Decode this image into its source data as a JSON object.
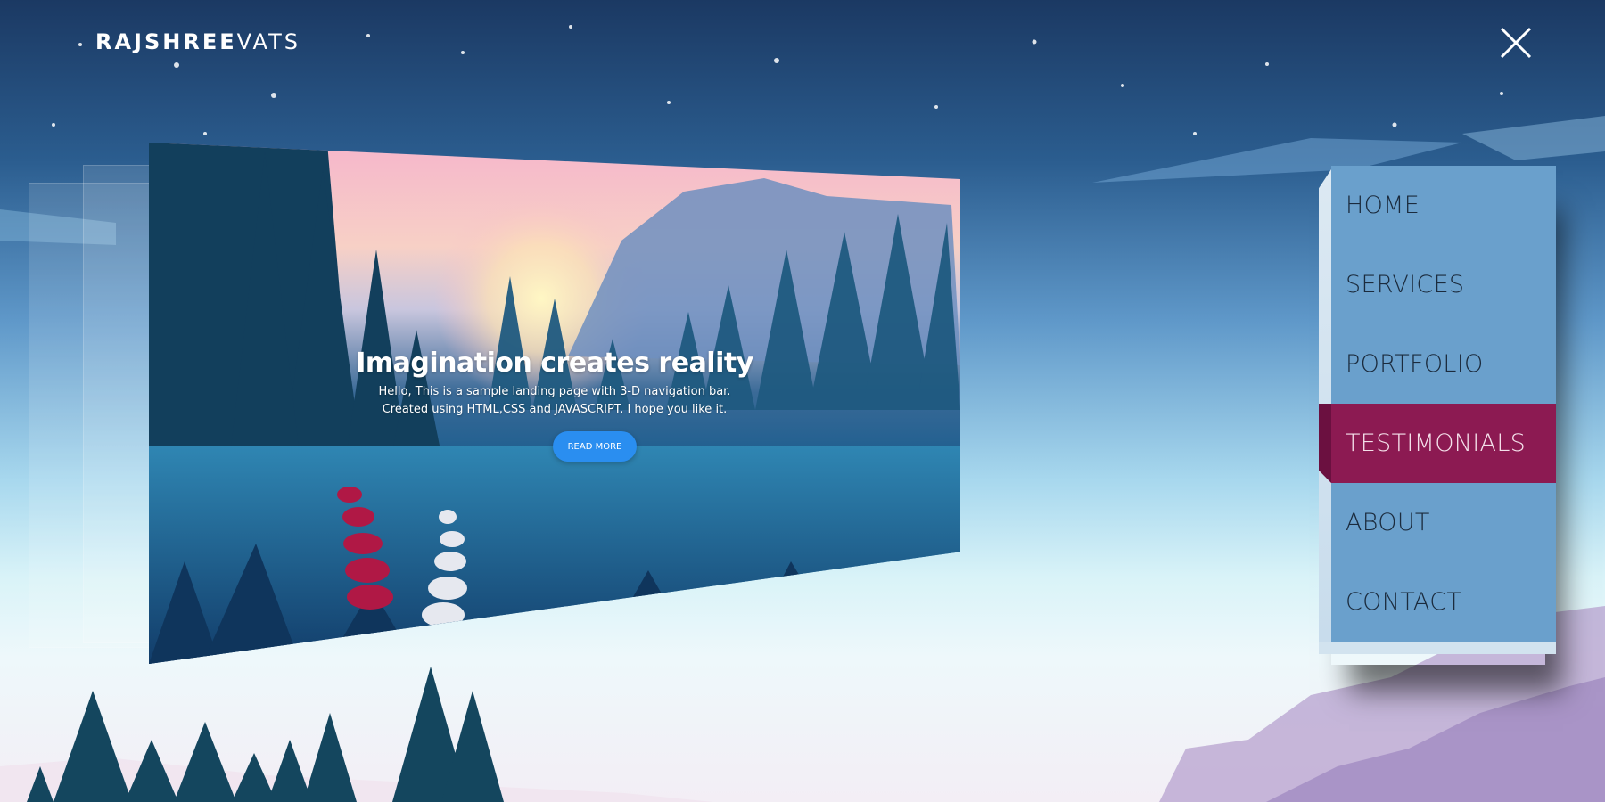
{
  "brand": {
    "bold": "RAJSHREE",
    "thin": "VATS"
  },
  "hero": {
    "title": "Imagination creates reality",
    "line1": "Hello, This is a sample landing page with 3-D navigation bar.",
    "line2": "Created using HTML,CSS and JAVASCRIPT. I hope you like it.",
    "button_label": "READ MORE"
  },
  "nav": {
    "items": [
      "HOME",
      "SERVICES",
      "PORTFOLIO",
      "TESTIMONIALS",
      "ABOUT",
      "CONTACT"
    ],
    "active": "TESTIMONIALS"
  },
  "icons": {
    "close": "close-icon"
  },
  "colors": {
    "nav_bg": "#6aa0cc",
    "nav_active": "#8c1a52",
    "button": "#2a8ef0"
  }
}
